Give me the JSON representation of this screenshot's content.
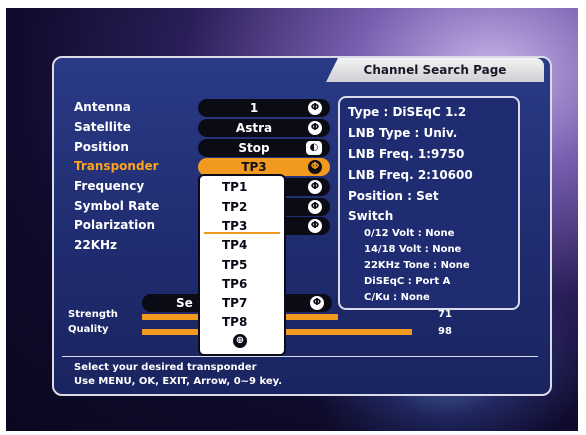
{
  "header": {
    "title": "Channel Search Page"
  },
  "settings": {
    "rows": [
      {
        "label": "Antenna",
        "value": "1",
        "icon": "adjust-icon"
      },
      {
        "label": "Satellite",
        "value": "Astra",
        "icon": "adjust-icon"
      },
      {
        "label": "Position",
        "value": "Stop",
        "icon": "motor-icon"
      },
      {
        "label": "Transponder",
        "value": "TP3",
        "icon": "adjust-icon",
        "active": true
      },
      {
        "label": "Frequency"
      },
      {
        "label": "Symbol Rate"
      },
      {
        "label": "Polarization"
      },
      {
        "label": "22KHz"
      }
    ]
  },
  "dropdown": {
    "items": [
      "TP1",
      "TP2",
      "TP3",
      "TP4",
      "TP5",
      "TP6",
      "TP7",
      "TP8"
    ],
    "selected": "TP3",
    "scroll_icon": "scroll-down-icon"
  },
  "info": {
    "type": "Type : DiSEqC 1.2",
    "lnb_type": "LNB Type : Univ.",
    "lnb_freq1": "LNB Freq. 1:9750",
    "lnb_freq2": "LNB Freq. 2:10600",
    "position": "Position : Set",
    "switch_title": "Switch",
    "switch_lines": [
      "0/12 Volt : None",
      "14/18 Volt : None",
      "22KHz Tone : None",
      "DiSEqC : Port A",
      "C/Ku : None"
    ]
  },
  "search": {
    "label": "Se"
  },
  "meters": {
    "strength": {
      "label": "Strength",
      "value": "71",
      "level": 0.71
    },
    "quality": {
      "label": "Quality",
      "value": "98",
      "level": 0.98
    }
  },
  "help": {
    "line1": "Select your desired transponder",
    "line2": "Use MENU, OK, EXIT, Arrow, 0~9 key."
  },
  "colors": {
    "accent": "#f19a1f",
    "highlight_text": "#ffa21c",
    "panel": "#1f2b6e"
  }
}
